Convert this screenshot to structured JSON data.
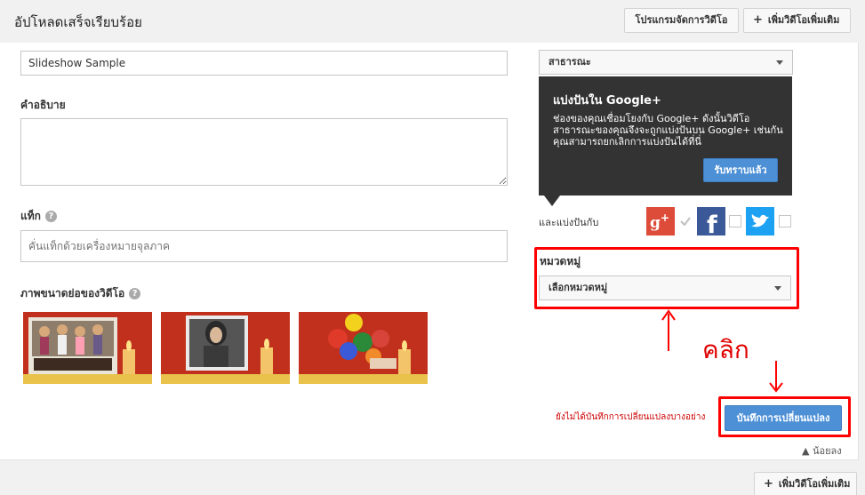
{
  "header": {
    "title": "อัปโหลดเสร็จเรียบร้อย",
    "video_manager_label": "โปรแกรมจัดการวิดีโอ",
    "add_more_label": "เพิ่มวิดีโอเพิ่มเติม"
  },
  "form": {
    "title_value": "Slideshow Sample",
    "description_label": "คำอธิบาย",
    "description_value": "",
    "tags_label": "แท็ก",
    "tags_placeholder": "คั่นแท็กด้วยเครื่องหมายจุลภาค",
    "thumbnails_label": "ภาพขนาดย่อของวิดีโอ"
  },
  "privacy": {
    "selected": "สาธารณะ"
  },
  "tooltip": {
    "title": "แบ่งปันใน Google+",
    "body": "ช่องของคุณเชื่อมโยงกับ Google+ ดังนั้นวิดีโอสาธารณะของคุณจึงจะถูกแบ่งปันบน Google+ เช่นกัน คุณสามารถยกเลิกการแบ่งปันได้ที่นี่",
    "button": "รับทราบแล้ว"
  },
  "share": {
    "label": "และแบ่งปันกับ",
    "networks": [
      "google-plus",
      "facebook",
      "twitter"
    ]
  },
  "category": {
    "label": "หมวดหมู่",
    "selected": "เลือกหมวดหมู่"
  },
  "annotations": {
    "click_text": "คลิก",
    "color": "#ff0000"
  },
  "footer": {
    "unsaved_text": "ยังไม่ได้บันทึกการเปลี่ยนแปลงบางอย่าง",
    "save_label": "บันทึกการเปลี่ยนแปลง",
    "less_label": "▲ น้อยลง",
    "add_more_label": "เพิ่มวิดีโอเพิ่มเติม"
  },
  "colors": {
    "primary_button": "#4d90d6",
    "tooltip_bg": "#333333",
    "google_red": "#dd4b39",
    "facebook_blue": "#3b5998",
    "twitter_blue": "#1da1f2"
  }
}
